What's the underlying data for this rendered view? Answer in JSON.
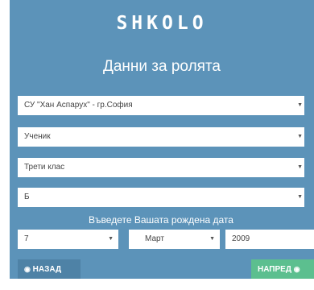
{
  "logo": "SHKOLO",
  "title": "Данни за ролята",
  "selects": {
    "school": "СУ \"Хан Аспарух\" - гр.София",
    "role": "Ученик",
    "class": "Трети клас",
    "section": "Б"
  },
  "dob": {
    "label": "Въведете Вашата рождена дата",
    "day": "7",
    "month": "Март",
    "year": "2009"
  },
  "buttons": {
    "back": "НАЗАД",
    "next": "НАПРЕД"
  },
  "icons": {
    "dropdown": "▼",
    "back": "◉",
    "next": "◉"
  },
  "colors": {
    "panel": "#5c93b9",
    "back_button": "#4e82a6",
    "next_button": "#5cbf8f"
  }
}
